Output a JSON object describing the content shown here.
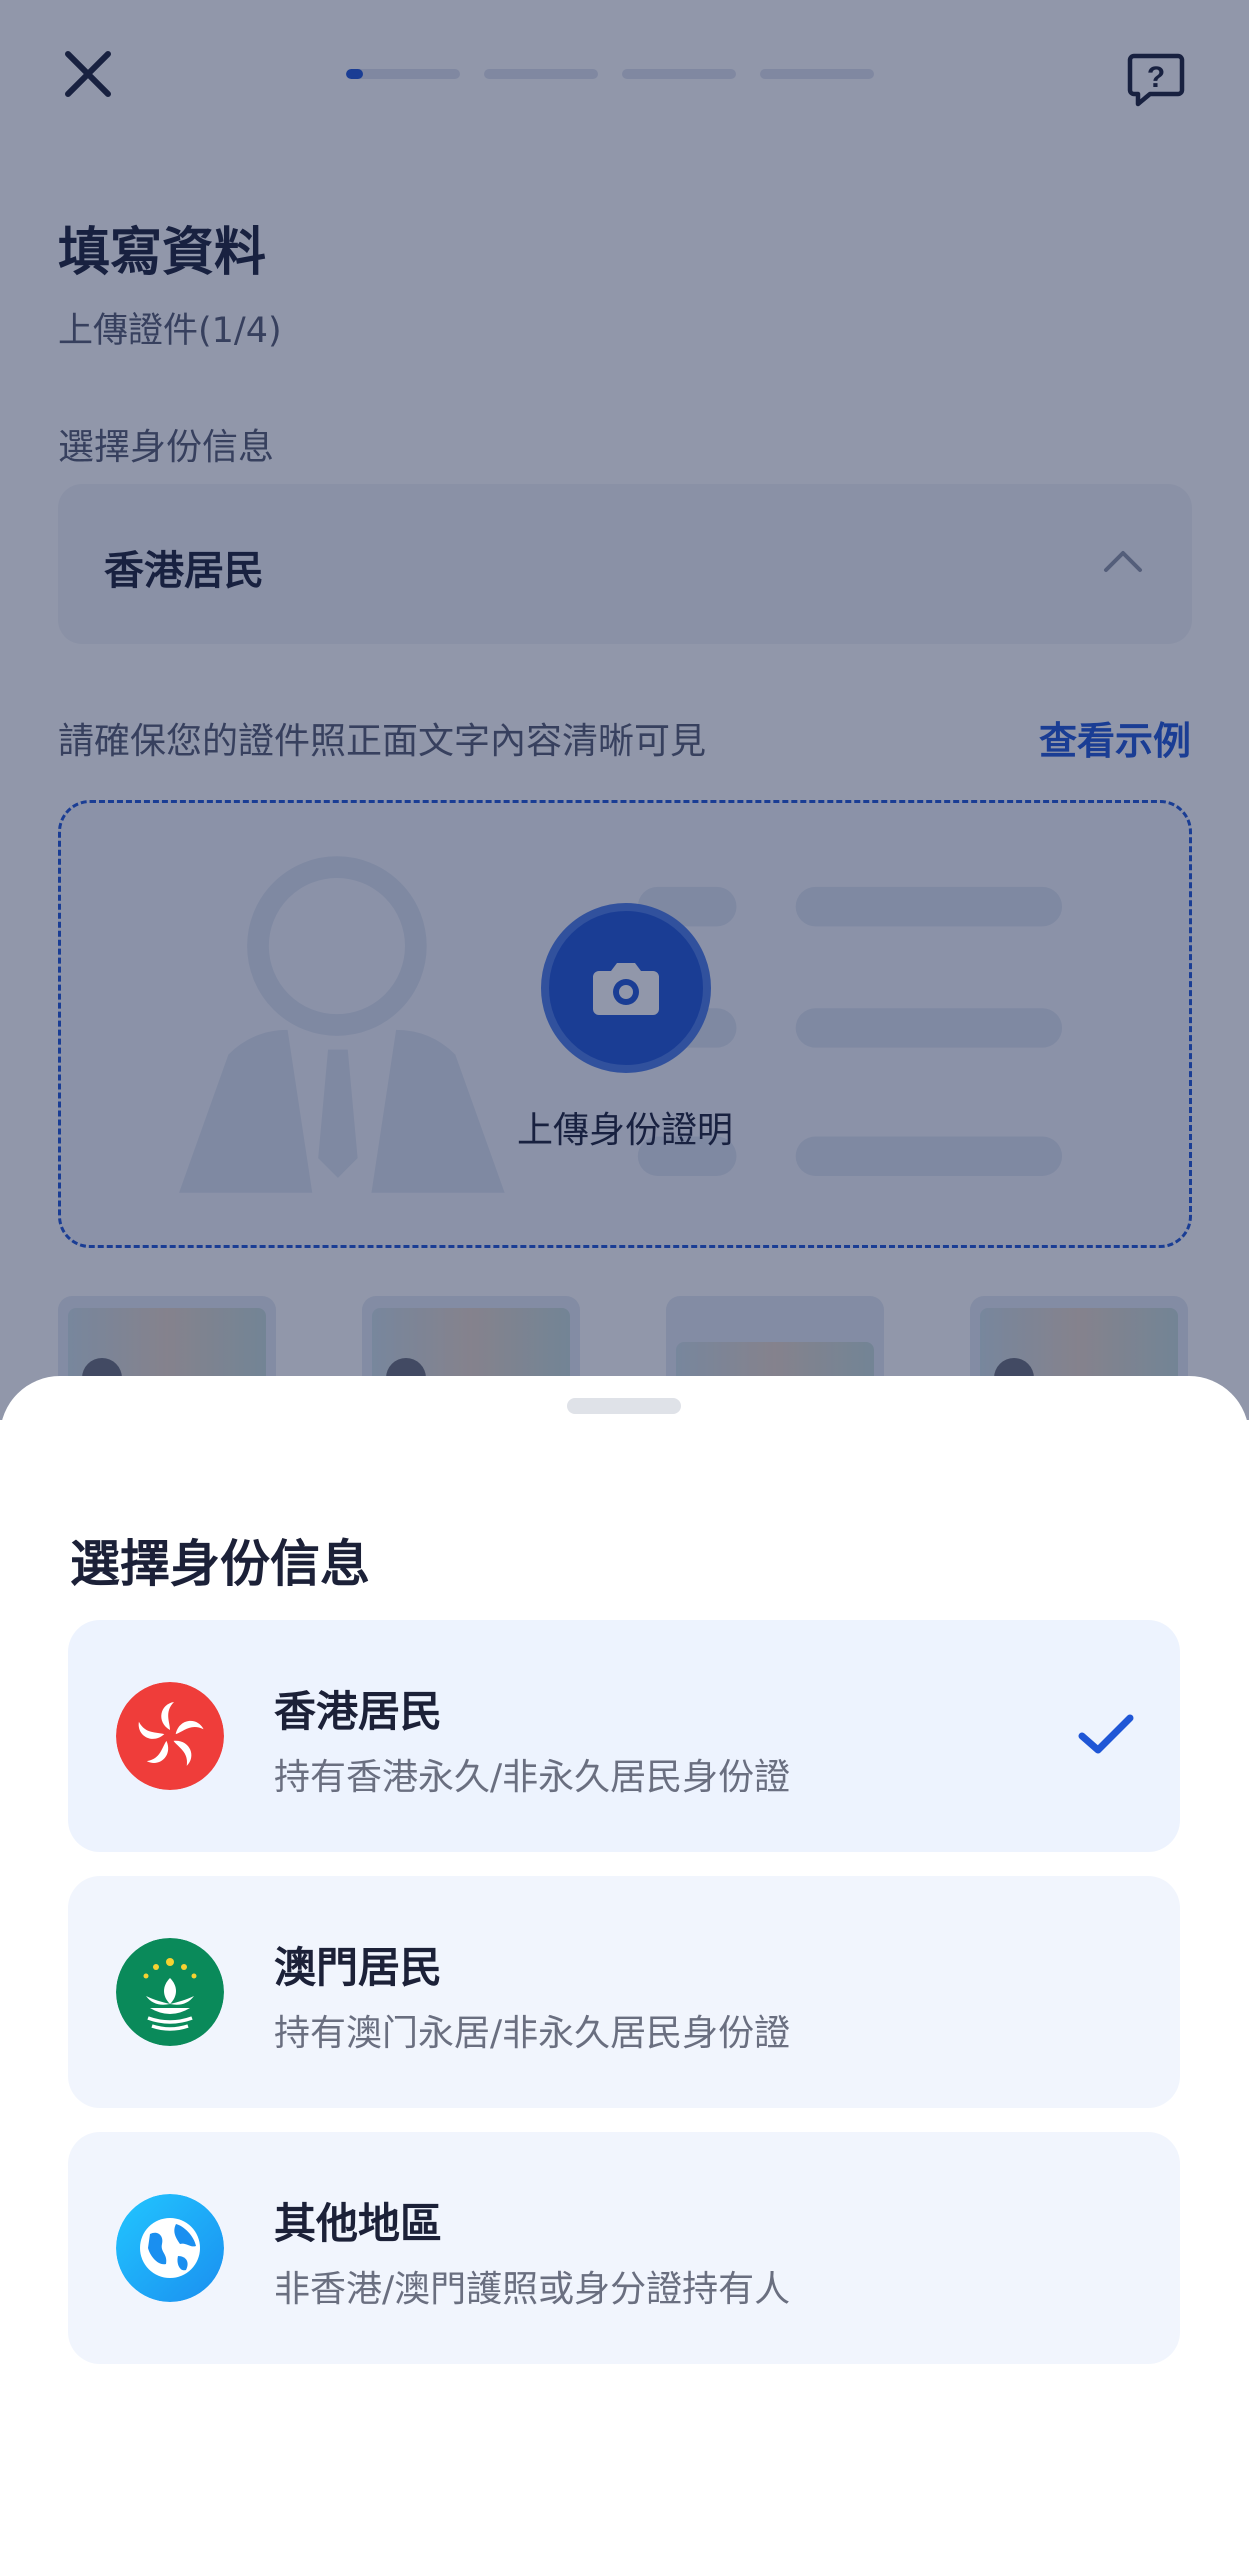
{
  "header": {
    "close_icon": "close-icon",
    "help_icon": "help-icon",
    "progress": {
      "step": 1,
      "total": 4,
      "current_fraction": 0.15
    }
  },
  "form": {
    "title": "填寫資料",
    "subtitle": "上傳證件(1/4)",
    "id_label": "選擇身份信息",
    "id_selected": "香港居民",
    "hint": "請確保您的證件照正面文字內容清晰可見",
    "example_link": "查看示例",
    "upload_label": "上傳身份證明"
  },
  "sheet": {
    "title": "選擇身份信息",
    "options": [
      {
        "name": "香港居民",
        "desc": "持有香港永久/非永久居民身份證",
        "icon": "hong-kong-flag-icon",
        "selected": true
      },
      {
        "name": "澳門居民",
        "desc": "持有澳门永居/非永久居民身份證",
        "icon": "macau-flag-icon",
        "selected": false
      },
      {
        "name": "其他地區",
        "desc": "非香港/澳門護照或身分證持有人",
        "icon": "globe-icon",
        "selected": false
      }
    ]
  },
  "colors": {
    "accent": "#1f56d6",
    "hk_red": "#ef3d3a",
    "macau_green": "#0a8a5a",
    "globe_blue": "#1ab0f5"
  }
}
